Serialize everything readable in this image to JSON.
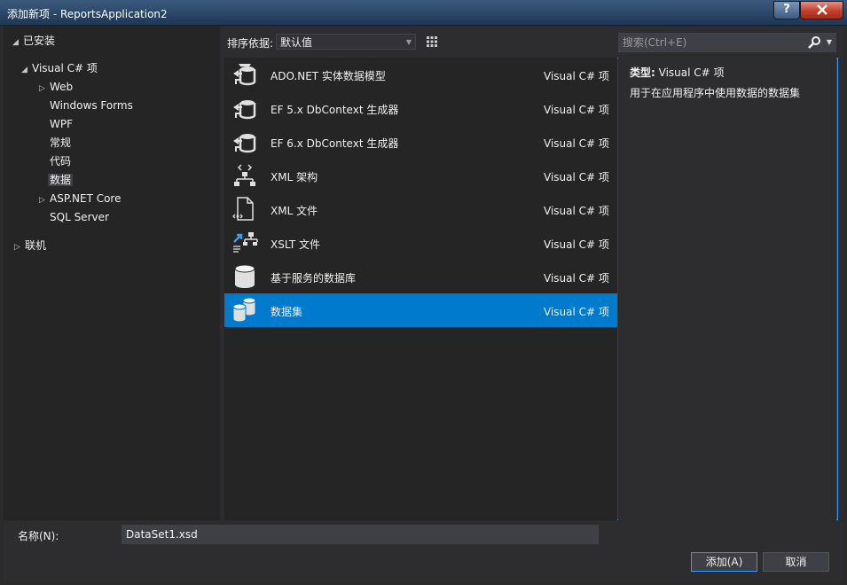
{
  "window": {
    "title": "添加新项 - ReportsApplication2",
    "help_label": "?",
    "close_label": "x"
  },
  "tree": {
    "installed": "已安装",
    "visual_cs": "Visual C# 项",
    "children": [
      "Web",
      "Windows Forms",
      "WPF",
      "常规",
      "代码",
      "数据",
      "ASP.NET Core",
      "SQL Server"
    ],
    "online": "联机"
  },
  "toolbar": {
    "sort_label": "排序依据:",
    "sort_value": "默认值"
  },
  "items": [
    {
      "name": "ADO.NET 实体数据模型",
      "category": "Visual C# 项",
      "icon": "entity-model-icon"
    },
    {
      "name": "EF 5.x DbContext 生成器",
      "category": "Visual C# 项",
      "icon": "dbcontext-generator-icon"
    },
    {
      "name": "EF 6.x DbContext 生成器",
      "category": "Visual C# 项",
      "icon": "dbcontext-generator-icon"
    },
    {
      "name": "XML 架构",
      "category": "Visual C# 项",
      "icon": "xml-schema-icon"
    },
    {
      "name": "XML 文件",
      "category": "Visual C# 项",
      "icon": "xml-file-icon"
    },
    {
      "name": "XSLT 文件",
      "category": "Visual C# 项",
      "icon": "xslt-file-icon"
    },
    {
      "name": "基于服务的数据库",
      "category": "Visual C# 项",
      "icon": "database-icon"
    },
    {
      "name": "数据集",
      "category": "Visual C# 项",
      "icon": "dataset-icon",
      "selected": true
    }
  ],
  "search": {
    "placeholder": "搜索(Ctrl+E)"
  },
  "details": {
    "type_label": "类型:",
    "type_value": "Visual C# 项",
    "description": "用于在应用程序中使用数据的数据集"
  },
  "bottom": {
    "name_label": "名称(N):",
    "name_value": "DataSet1.xsd",
    "add_label": "添加(A)",
    "cancel_label": "取消"
  },
  "colors": {
    "accent": "#007acc",
    "background": "#2d2d30",
    "panel": "#252526"
  }
}
